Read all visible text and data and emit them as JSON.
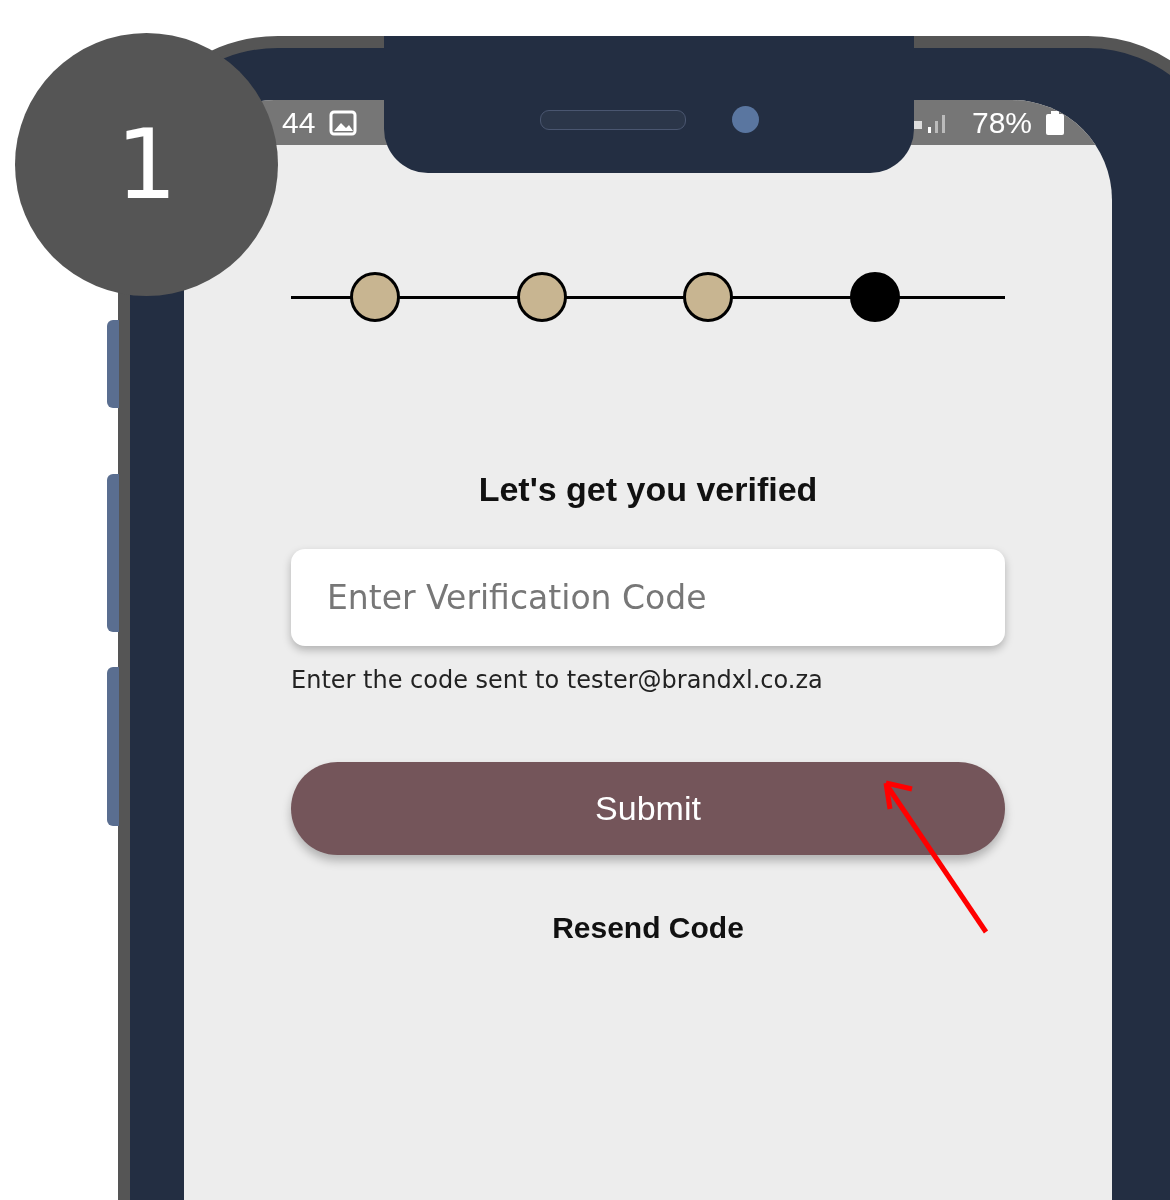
{
  "step_badge": "1",
  "status_bar": {
    "time": "44",
    "battery": "78%"
  },
  "stepper": [
    {
      "completed": true,
      "selected": false
    },
    {
      "completed": true,
      "selected": false
    },
    {
      "completed": true,
      "selected": false
    },
    {
      "completed": false,
      "selected": true
    }
  ],
  "title": "Let's get you verified",
  "code_field": {
    "placeholder": "Enter Verification Code"
  },
  "helper_text": "Enter the code sent to tester@brandxl.co.za",
  "submit_button": "Submit",
  "resend_link": "Resend Code"
}
